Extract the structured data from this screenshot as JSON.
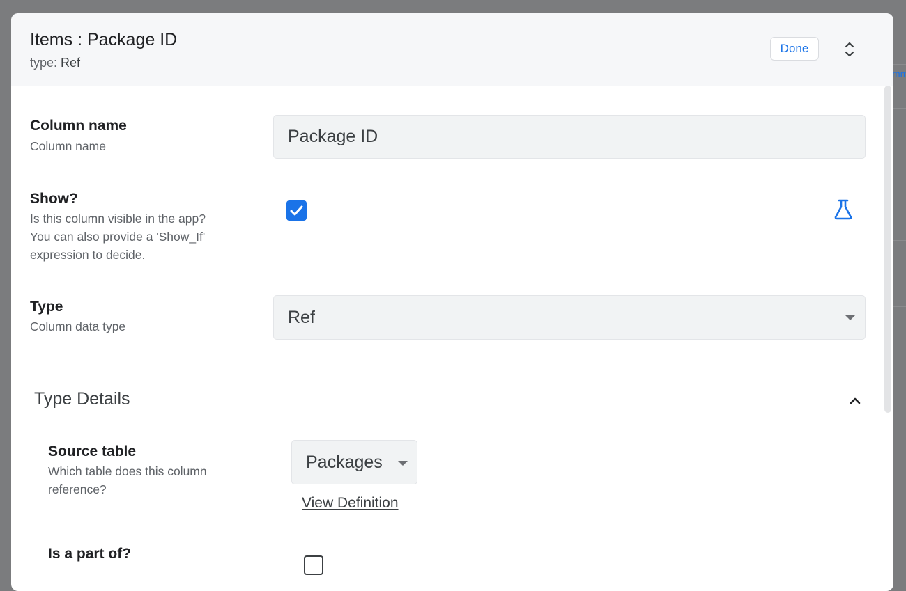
{
  "dialog": {
    "title": "Items : Package ID",
    "subtitle_prefix": "type:",
    "subtitle_value": "Ref",
    "done_label": "Done"
  },
  "background": {
    "partial_text": "mm"
  },
  "fields": {
    "column_name": {
      "label": "Column name",
      "description": "Column name",
      "value": "Package ID"
    },
    "show": {
      "label": "Show?",
      "description_lines": [
        "Is this column visible in the app?",
        "You can also provide a 'Show_If'",
        "expression to decide."
      ],
      "checked": true
    },
    "type": {
      "label": "Type",
      "description": "Column data type",
      "value": "Ref"
    }
  },
  "type_details": {
    "title": "Type Details",
    "source_table": {
      "label": "Source table",
      "description_lines": [
        "Which table does this column",
        "reference?"
      ],
      "value": "Packages",
      "link_label": "View Definition"
    },
    "is_part_of": {
      "label": "Is a part of?",
      "checked": false
    }
  },
  "colors": {
    "accent": "#1a73e8",
    "overlay": "#7b7c7e"
  }
}
